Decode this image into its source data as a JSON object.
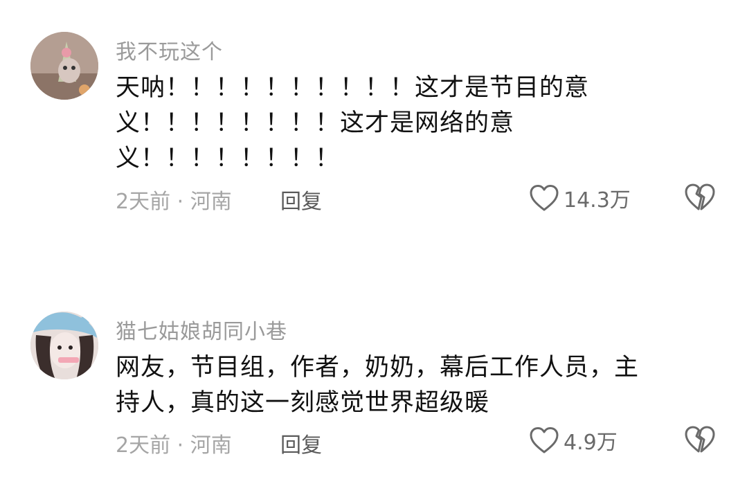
{
  "comments": [
    {
      "username": "我不玩这个",
      "lines": [
        "天呐！！！！！！！！！！这才是节目的意",
        "义！！！！！！！！这才是网络的意",
        "义！！！！！！！！"
      ],
      "meta": "2天前 · 河南",
      "reply_label": "回复",
      "likes": "14.3万",
      "like_icon": "heart-outline-icon",
      "dislike_icon": "broken-heart-icon"
    },
    {
      "username": "猫七姑娘胡同小巷",
      "lines": [
        "网友，节目组，作者，奶奶，幕后工作人员，主",
        "持人，真的这一刻感觉世界超级暖"
      ],
      "meta": "2天前 · 河南",
      "reply_label": "回复",
      "likes": "4.9万",
      "like_icon": "heart-outline-icon",
      "dislike_icon": "broken-heart-icon"
    }
  ],
  "colors": {
    "username": "#9a9a9a",
    "content": "#111111",
    "meta": "#a5a5a5",
    "reply": "#5a5a5a",
    "icon": "#6a6a6a"
  }
}
